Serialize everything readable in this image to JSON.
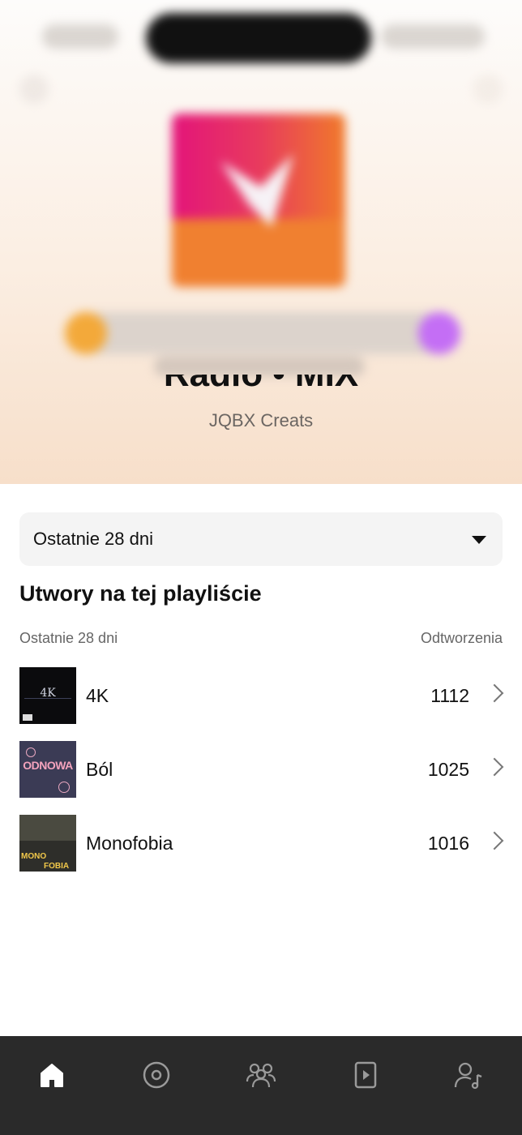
{
  "header": {
    "playlist_title": "Radio • MIX",
    "owner": "JQBX Creats"
  },
  "filter": {
    "selected": "Ostatnie 28 dni"
  },
  "tracks_section": {
    "title": "Utwory na tej playliście",
    "col_period": "Ostatnie 28 dni",
    "col_plays": "Odtworzenia",
    "items": [
      {
        "name": "4K",
        "plays": "1112",
        "cover_text": "4K"
      },
      {
        "name": "Ból",
        "plays": "1025",
        "cover_text": "ODNOWA"
      },
      {
        "name": "Monofobia",
        "plays": "1016",
        "cover_text_1": "MONO",
        "cover_text_2": "FOBIA"
      }
    ]
  },
  "bottom_nav": {
    "items": [
      "home-icon",
      "discover-icon",
      "community-icon",
      "player-icon",
      "profile-icon"
    ],
    "active": "home-icon"
  },
  "colors": {
    "header_gradient_end": "#f7dfca",
    "bottom_bar": "#2a2a2a",
    "active_tab": "#ffffff",
    "inactive_tab": "#9a9a9a"
  }
}
